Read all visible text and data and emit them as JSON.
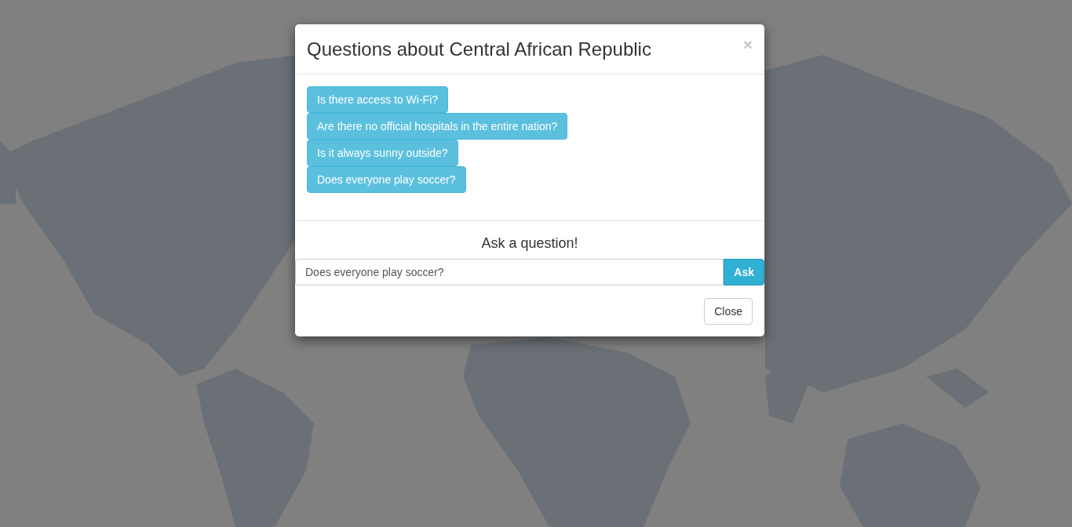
{
  "modal": {
    "title": "Questions about Central African Republic",
    "close_icon": "×",
    "questions": [
      {
        "label": "Is there access to Wi-Fi?"
      },
      {
        "label": "Are there no official hospitals in the entire nation?"
      },
      {
        "label": "Is it always sunny outside?"
      },
      {
        "label": "Does everyone play soccer?"
      }
    ],
    "ask_heading": "Ask a question!",
    "ask_field": {
      "value": "Does everyone play soccer?"
    },
    "ask_button": "Ask",
    "footer_buttons": [
      "Close"
    ]
  }
}
